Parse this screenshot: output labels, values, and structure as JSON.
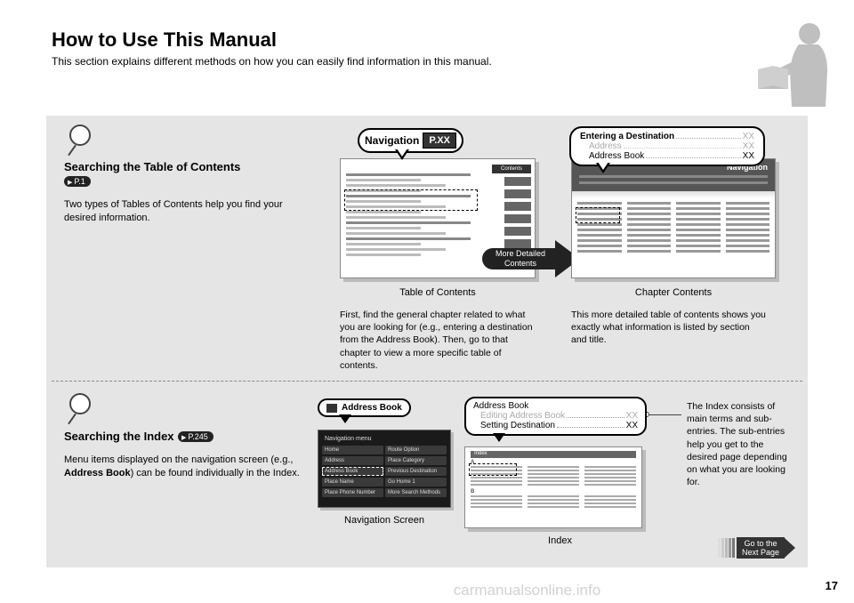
{
  "header": {
    "title": "How to Use This Manual",
    "subtitle": "This section explains different methods on how you can easily find information in this manual."
  },
  "section1": {
    "title": "Searching the Table of Contents",
    "pill": "P.1",
    "body": "Two types of Tables of Contents help you find your desired information.",
    "nav_callout_label": "Navigation",
    "nav_callout_page": "P.XX",
    "contents_tab": "Contents",
    "arrow_label_line1": "More Detailed",
    "arrow_label_line2": "Contents",
    "toc_caption": "Table of Contents",
    "toc_body": "First, find the general chapter related to what you are looking for (e.g., entering a destination from the Address Book). Then, go to that chapter to view a more specific table of contents.",
    "chapter_nav_label": "Navigation",
    "dest_callout": {
      "row1_label": "Entering a Destination",
      "row1_page": "XX",
      "row2_label": "Address",
      "row2_page": "XX",
      "row3_label": "Address Book",
      "row3_page": "XX"
    },
    "chapter_caption": "Chapter Contents",
    "chapter_body": "This more detailed table of contents shows you exactly what information is listed by section and title."
  },
  "section2": {
    "title": "Searching the Index",
    "pill": "P.245",
    "body_pre": "Menu items displayed on the navigation screen (e.g., ",
    "body_bold": "Address Book",
    "body_post": ") can be found individually in the Index.",
    "addr_callout": "Address Book",
    "nav_screen": {
      "title": "Navigation menu",
      "buttons": [
        "Home",
        "Route Option",
        "Address",
        "Place Category",
        "Address Book",
        "Previous Destination",
        "Place Name",
        "Go Home 1",
        "Place Phone Number",
        "More Search Methods"
      ]
    },
    "nav_caption": "Navigation Screen",
    "idx_callout": {
      "row1_label": "Address Book",
      "row2_label": "Editing Address Book",
      "row2_page": "XX",
      "row3_label": "Setting Destination",
      "row3_page": "XX"
    },
    "index_head": "Index",
    "letter_a": "A",
    "letter_b": "B",
    "index_caption": "Index",
    "explanation": "The Index consists of main terms and sub-entries. The sub-entries help you get to the desired page depending on what you are looking for."
  },
  "next_page": {
    "line1": "Go to the",
    "line2": "Next Page"
  },
  "page_number": "17",
  "watermark": "carmanualsonline.info"
}
